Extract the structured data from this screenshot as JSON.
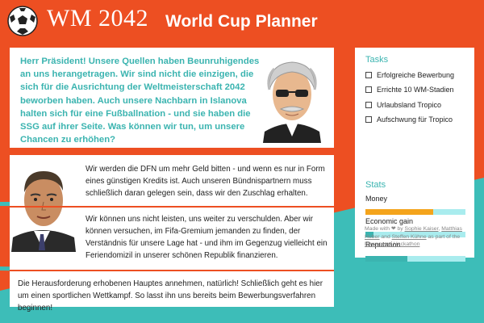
{
  "header": {
    "logo_text": "WM 2042",
    "app_title": "World Cup Planner"
  },
  "president": {
    "text": "Herr Präsident! Unsere Quellen haben Beunruhigendes an uns herangetragen. Wir sind nicht die einzigen, die sich für die Ausrichtung der Weltmeisterschaft 2042 beworben haben. Auch unsere Nachbarn in Islanova halten sich für eine Fußballnation - und sie haben die SSG auf ihrer Seite. Was können wir tun, um unsere Chancen zu erhöhen?"
  },
  "options": [
    {
      "text": "Wir werden die DFN um mehr Geld bitten - und wenn es nur in Form eines günstigen Kredits ist. Auch unseren Bündnispartnern muss schließlich daran gelegen sein, dass wir den Zuschlag erhalten."
    },
    {
      "text": "Wir können uns nicht leisten, uns weiter zu verschulden. Aber wir können versuchen, im Fifa-Gremium jemanden zu finden, der Verständnis für unsere Lage hat - und ihm im Gegenzug vielleicht ein Feriendomizil in unserer schönen Republik finanzieren."
    },
    {
      "text": "Die Herausforderung erhobenen Hauptes annehmen, natürlich! Schließlich geht es hier um einen sportlichen Wettkampf. So lasst ihn uns bereits beim Bewerbungsverfahren beginnen!"
    }
  ],
  "sidebar": {
    "tasks_heading": "Tasks",
    "tasks": [
      {
        "label": "Erfolgreiche Bewerbung",
        "done": false
      },
      {
        "label": "Errichte 10 WM-Stadien",
        "done": false
      },
      {
        "label": "Urlaubsland Tropico",
        "done": false
      },
      {
        "label": "Aufschwung für Tropico",
        "done": false
      }
    ],
    "stats_heading": "Stats",
    "stats": [
      {
        "label": "Money",
        "value": 0.68,
        "color": "#f4a41c"
      },
      {
        "label": "Economic gain",
        "value": 0.08,
        "color": "#3bb4b0"
      },
      {
        "label": "Reputation",
        "value": 0.42,
        "color": "#3bb4b0"
      }
    ],
    "credits": {
      "prefix": "Made with ❤ by",
      "author1": "Sophie Kaiser",
      "sep1": ",",
      "author2": "Matthias Huber",
      "and": "and",
      "author3": "Steffen Kühne",
      "suffix": "as part of the",
      "event": "Newsgame Hackathon"
    }
  },
  "colors": {
    "orange": "#ed4f22",
    "teal": "#3dbdb8",
    "teal_text": "#3bb4b0",
    "bar_track": "#a9ecee",
    "money_fill": "#f4a41c"
  },
  "icons": [
    "soccer-ball-icon",
    "checkbox-icon"
  ]
}
